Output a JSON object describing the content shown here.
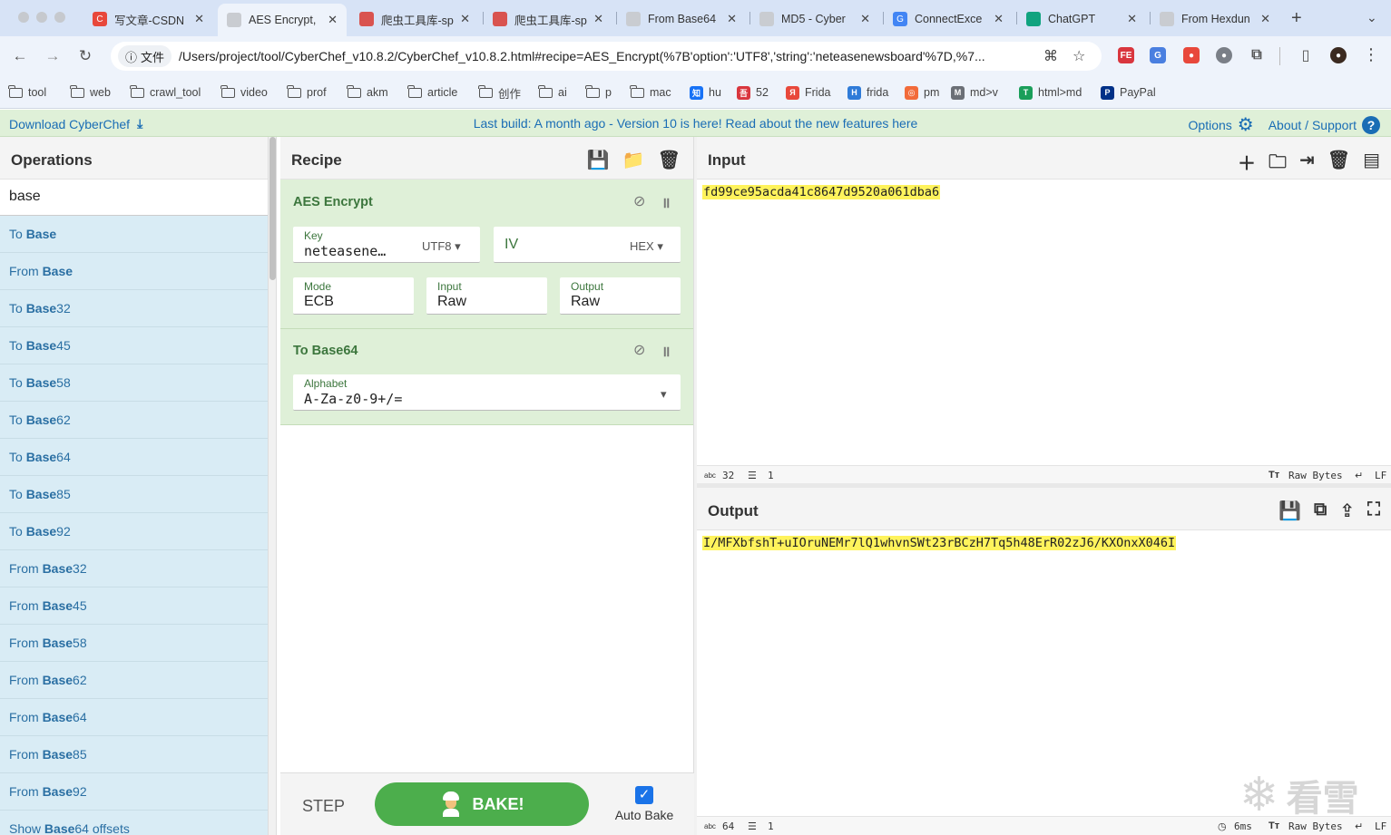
{
  "browser": {
    "tabs": [
      {
        "title": "写文章-CSDN",
        "fav": "C",
        "color": "#e8483b",
        "active": false
      },
      {
        "title": "AES Encrypt,",
        "fav": "",
        "color": "#c9ccd1",
        "active": true
      },
      {
        "title": "爬虫工具库-sp",
        "fav": "",
        "color": "#d9534f",
        "active": false
      },
      {
        "title": "爬虫工具库-sp",
        "fav": "",
        "color": "#d9534f",
        "active": false
      },
      {
        "title": "From Base64",
        "fav": "",
        "color": "#c9ccd1",
        "active": false
      },
      {
        "title": "MD5 - Cyber",
        "fav": "",
        "color": "#c9ccd1",
        "active": false
      },
      {
        "title": "ConnectExce",
        "fav": "G",
        "color": "#4285f4",
        "active": false
      },
      {
        "title": "ChatGPT",
        "fav": "",
        "color": "#10a37f",
        "active": false
      },
      {
        "title": "From Hexdun",
        "fav": "",
        "color": "#c9ccd1",
        "active": false
      }
    ],
    "new_tab": "+",
    "site_chip": "文件",
    "url": "/Users/project/tool/CyberChef_v10.8.2/CyberChef_v10.8.2.html#recipe=AES_Encrypt(%7B'option':'UTF8','string':'neteasenewsboard'%7D,%7...",
    "bookmarks": [
      {
        "label": "tool",
        "type": "folder"
      },
      {
        "label": "web",
        "type": "folder"
      },
      {
        "label": "crawl_tool",
        "type": "folder"
      },
      {
        "label": "video",
        "type": "folder"
      },
      {
        "label": "prof",
        "type": "folder"
      },
      {
        "label": "akm",
        "type": "folder"
      },
      {
        "label": "article",
        "type": "folder"
      },
      {
        "label": "创作",
        "type": "folder"
      },
      {
        "label": "ai",
        "type": "folder"
      },
      {
        "label": "p",
        "type": "folder"
      },
      {
        "label": "mac",
        "type": "folder"
      },
      {
        "label": "hu",
        "type": "site",
        "glyph": "知",
        "color": "#1772f6"
      },
      {
        "label": "52",
        "type": "site",
        "glyph": "吾",
        "color": "#d9363e"
      },
      {
        "label": "Frida",
        "type": "site",
        "glyph": "Я",
        "color": "#e8483b"
      },
      {
        "label": "frida",
        "type": "site",
        "glyph": "H",
        "color": "#2f7bd8"
      },
      {
        "label": "pm",
        "type": "site",
        "glyph": "◎",
        "color": "#f26b3a"
      },
      {
        "label": "md>v",
        "type": "site",
        "glyph": "M",
        "color": "#6b6f76"
      },
      {
        "label": "html>md",
        "type": "site",
        "glyph": "T",
        "color": "#1a9e5a"
      },
      {
        "label": "PayPal",
        "type": "site",
        "glyph": "P",
        "color": "#003087"
      }
    ]
  },
  "banner": {
    "download": "Download CyberChef",
    "center": "Last build: A month ago - Version 10 is here! Read about the new features here",
    "options": "Options",
    "about": "About / Support"
  },
  "operations": {
    "title": "Operations",
    "search_value": "base",
    "items": [
      {
        "prefix": "To ",
        "match": "Base",
        "suffix": ""
      },
      {
        "prefix": "From ",
        "match": "Base",
        "suffix": ""
      },
      {
        "prefix": "To ",
        "match": "Base",
        "suffix": "32"
      },
      {
        "prefix": "To ",
        "match": "Base",
        "suffix": "45"
      },
      {
        "prefix": "To ",
        "match": "Base",
        "suffix": "58"
      },
      {
        "prefix": "To ",
        "match": "Base",
        "suffix": "62"
      },
      {
        "prefix": "To ",
        "match": "Base",
        "suffix": "64"
      },
      {
        "prefix": "To ",
        "match": "Base",
        "suffix": "85"
      },
      {
        "prefix": "To ",
        "match": "Base",
        "suffix": "92"
      },
      {
        "prefix": "From ",
        "match": "Base",
        "suffix": "32"
      },
      {
        "prefix": "From ",
        "match": "Base",
        "suffix": "45"
      },
      {
        "prefix": "From ",
        "match": "Base",
        "suffix": "58"
      },
      {
        "prefix": "From ",
        "match": "Base",
        "suffix": "62"
      },
      {
        "prefix": "From ",
        "match": "Base",
        "suffix": "64"
      },
      {
        "prefix": "From ",
        "match": "Base",
        "suffix": "85"
      },
      {
        "prefix": "From ",
        "match": "Base",
        "suffix": "92"
      },
      {
        "prefix": "Show ",
        "match": "Base",
        "suffix": "64 offsets"
      }
    ]
  },
  "recipe": {
    "title": "Recipe",
    "aes": {
      "name": "AES Encrypt",
      "key_label": "Key",
      "key_value": "neteasene…",
      "key_encoding": "UTF8",
      "iv_label": "IV",
      "iv_encoding": "HEX",
      "mode_label": "Mode",
      "mode_value": "ECB",
      "input_label": "Input",
      "input_value": "Raw",
      "output_label": "Output",
      "output_value": "Raw"
    },
    "tobase64": {
      "name": "To Base64",
      "alphabet_label": "Alphabet",
      "alphabet_value": "A-Za-z0-9+/="
    },
    "step": "STEP",
    "bake": "BAKE!",
    "auto_bake": "Auto Bake"
  },
  "input": {
    "title": "Input",
    "text": "fd99ce95acda41c8647d9520a061dba6",
    "status": {
      "chars": "32",
      "lines": "1",
      "format": "Raw Bytes",
      "eol": "LF",
      "abc": "abc"
    }
  },
  "output": {
    "title": "Output",
    "text": "I/MFXbfshT+uIOruNEMr7lQ1whvnSWt23rBCzH7Tq5h48ErR02zJ6/KXOnxX046I",
    "status": {
      "chars": "64",
      "lines": "1",
      "time": "6ms",
      "format": "Raw Bytes",
      "eol": "LF",
      "abc": "abc"
    }
  },
  "watermark": "看雪"
}
